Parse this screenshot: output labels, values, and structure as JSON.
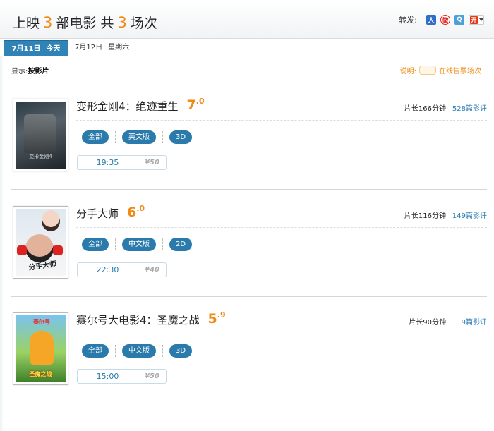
{
  "header": {
    "title_prefix": "上映",
    "movie_count": "3",
    "title_middle": "部电影 共",
    "show_count": "3",
    "title_suffix": "场次",
    "share_label": "转发:",
    "share_icons": [
      "renren-icon",
      "weibo-icon",
      "qzone-icon",
      "more-share-icon"
    ],
    "share_more_glyph": "开"
  },
  "dates": [
    {
      "date": "7月11日",
      "day": "今天",
      "active": true
    },
    {
      "date": "7月12日",
      "day": "星期六",
      "active": false
    }
  ],
  "display": {
    "label": "显示:",
    "mode": "按影片",
    "legend_label": "说明:",
    "legend_text": "在线售票场次"
  },
  "movies": [
    {
      "title": "变形金刚4：绝迹重生",
      "score_int": "7",
      "score_dec": ".0",
      "runtime": "片长166分钟",
      "reviews": "528篇影评",
      "filters": [
        "全部",
        "英文版",
        "3D"
      ],
      "showtimes": [
        {
          "time": "19:35",
          "price": "¥50"
        }
      ]
    },
    {
      "title": "分手大师",
      "score_int": "6",
      "score_dec": ".0",
      "runtime": "片长116分钟",
      "reviews": "149篇影评",
      "filters": [
        "全部",
        "中文版",
        "2D"
      ],
      "showtimes": [
        {
          "time": "22:30",
          "price": "¥40"
        }
      ]
    },
    {
      "title": "赛尔号大电影4：圣魔之战",
      "score_int": "5",
      "score_dec": ".9",
      "runtime": "片长90分钟",
      "reviews": "9篇影评",
      "filters": [
        "全部",
        "中文版",
        "3D"
      ],
      "showtimes": [
        {
          "time": "15:00",
          "price": "¥50"
        }
      ]
    }
  ],
  "colors": {
    "accent_orange": "#f08a14",
    "primary_blue": "#2a7aab",
    "active_tab": "#2f83b6"
  }
}
